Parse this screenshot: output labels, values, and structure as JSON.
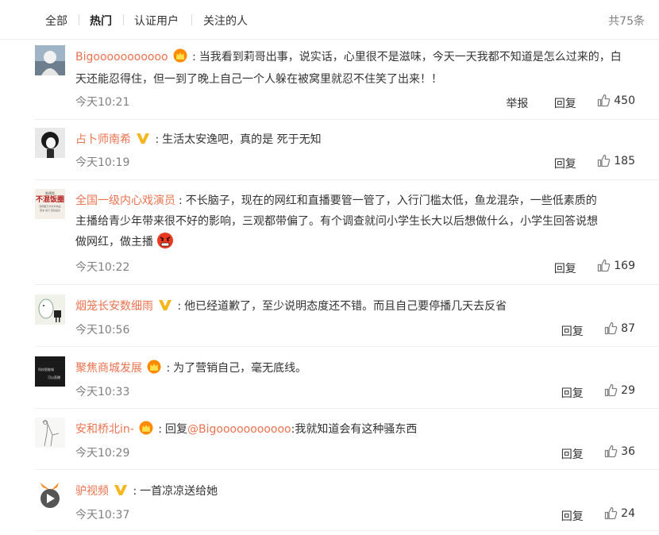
{
  "tabs": {
    "items": [
      {
        "label": "全部"
      },
      {
        "label": "热门"
      },
      {
        "label": "认证用户"
      },
      {
        "label": "关注的人"
      }
    ],
    "active_index": 1,
    "total": "共75条"
  },
  "actions": {
    "report": "举报",
    "reply": "回复"
  },
  "comments": [
    {
      "user": "Bigooooooooooo",
      "badge": "crown",
      "text": "当我看到莉哥出事，说实话，心里很不是滋味，今天一天我都不知道是怎么过来的，白",
      "text2": "天还能忍得住，但一到了晚上自己一个人躲在被窝里就忍不住笑了出来！！",
      "time": "今天10:21",
      "likes": "450"
    },
    {
      "user": "占卜师南希",
      "badge": "v",
      "text": "生活太安逸吧，真的是 死于无知",
      "time": "今天10:19",
      "likes": "185"
    },
    {
      "user": "全国一级内心戏演员",
      "text": "不长脑子，现在的网红和直播要管一管了，入行门槛太低，鱼龙混杂，一些低素质的",
      "text2": "主播给青少年带来很不好的影响，三观都带偏了。有个调查就问小学生长大以后想做什么，小学生回答说想",
      "text3": "做网红，做主播",
      "emoji": "angry",
      "time": "今天10:22",
      "likes": "169"
    },
    {
      "user": "烟笼长安数细雨",
      "badge": "v",
      "text": "他已经道歉了，至少说明态度还不错。而且自己要停播几天去反省",
      "time": "今天10:56",
      "likes": "87"
    },
    {
      "user": "聚焦商城发展",
      "badge": "crown",
      "text": "为了营销自己，毫无底线。",
      "time": "今天10:33",
      "likes": "29"
    },
    {
      "user": "安和桥北in-",
      "badge": "crown",
      "reply_prefix": "回复",
      "reply_to": "@Bigooooooooooo",
      "text": ":我就知道会有这种骚东西",
      "time": "今天10:29",
      "likes": "36"
    },
    {
      "user": "驴视频",
      "badge": "v",
      "text": "一首凉凉送给她",
      "time": "今天10:37",
      "likes": "24"
    }
  ],
  "avatar3_text": {
    "small": "陈德智",
    "big": "不混饭圈",
    "line1": "和明星艺术系列作品",
    "line2": "西沫·来打·回复品谈"
  },
  "avatar5_text": {
    "line1": "科技智能城",
    "line2": "可以直播"
  },
  "colors": {
    "username": "#eb7350",
    "muted": "#808080",
    "verified": "#f6b61e"
  }
}
